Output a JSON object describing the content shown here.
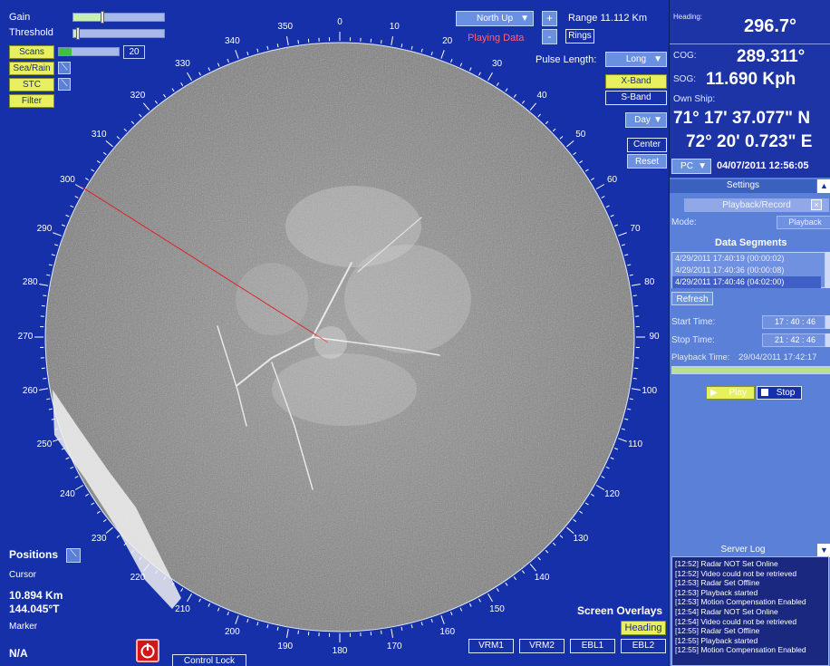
{
  "controls": {
    "gain_label": "Gain",
    "threshold_label": "Threshold",
    "scans_label": "Scans",
    "scans_value": "20",
    "sea_rain_label": "Sea/Rain",
    "stc_label": "STC",
    "filter_label": "Filter",
    "gain_level": 0.3,
    "threshold_level": 0.03
  },
  "top": {
    "orientation": "North Up",
    "plus": "+",
    "minus": "-",
    "range": "Range 11.112 Km",
    "rings": "Rings",
    "status": "Playing Data",
    "pulse_label": "Pulse Length:",
    "pulse_value": "Long",
    "x_band": "X-Band",
    "s_band": "S-Band",
    "day": "Day",
    "center": "Center",
    "reset": "Reset"
  },
  "bearings": [
    "0",
    "10",
    "20",
    "30",
    "40",
    "50",
    "60",
    "70",
    "80",
    "90",
    "100",
    "110",
    "120",
    "130",
    "140",
    "150",
    "160",
    "170",
    "180",
    "190",
    "200",
    "210",
    "220",
    "230",
    "240",
    "250",
    "260",
    "270",
    "280",
    "290",
    "300",
    "310",
    "320",
    "330",
    "340",
    "350"
  ],
  "positions": {
    "title": "Positions",
    "cursor_label": "Cursor",
    "cursor_range": "10.894 Km",
    "cursor_bearing": "144.045°T",
    "marker_label": "Marker",
    "marker_value": "N/A"
  },
  "bottom": {
    "control_lock": "Control Lock",
    "screen_overlays": "Screen Overlays",
    "heading_btn": "Heading",
    "vrm1": "VRM1",
    "vrm2": "VRM2",
    "ebl1": "EBL1",
    "ebl2": "EBL2"
  },
  "panel": {
    "heading_label": "Heading:",
    "heading_value": "296.7°",
    "cog_label": "COG:",
    "cog_value": "289.311°",
    "sog_label": "SOG:",
    "sog_value": "11.690 Kph",
    "own_ship_label": "Own Ship:",
    "lat": "71° 17' 37.077\" N",
    "lon": "72° 20' 0.723\" E",
    "pc": "PC",
    "datetime": "04/07/2011 12:56:05",
    "settings": "Settings",
    "playback_record": "Playback/Record",
    "mode_label": "Mode:",
    "mode_value": "Playback",
    "data_segments": "Data Segments",
    "segments": [
      "4/29/2011 17:40:19 (00:00:02)",
      "4/29/2011 17:40:36 (00:00:08)",
      "4/29/2011 17:40:46 (04:02:00)"
    ],
    "refresh": "Refresh",
    "start_label": "Start Time:",
    "start_value": "17 : 40 : 46",
    "stop_label": "Stop Time:",
    "stop_value": "21 : 42 : 46",
    "playback_time_label": "Playback Time:",
    "playback_time_value": "29/04/2011 17:42:17",
    "play": "Play",
    "stop": "Stop",
    "server_log": "Server Log",
    "log": [
      "[12:52] Radar NOT Set Online",
      "[12:52] Video could not be retrieved",
      "[12:53] Radar Set Offline",
      "[12:53] Playback started",
      "[12:53] Motion Compensation Enabled",
      "[12:54] Radar NOT Set Online",
      "[12:54] Video could not be retrieved",
      "[12:55] Radar Set Offline",
      "[12:55] Playback started",
      "[12:55] Motion Compensation Enabled"
    ]
  },
  "colors": {
    "background": "#1530a8",
    "panel": "#5a80d8",
    "accent_yellow": "#e8f060",
    "status_pink": "#ff6080",
    "heading_line": "#e02020"
  }
}
